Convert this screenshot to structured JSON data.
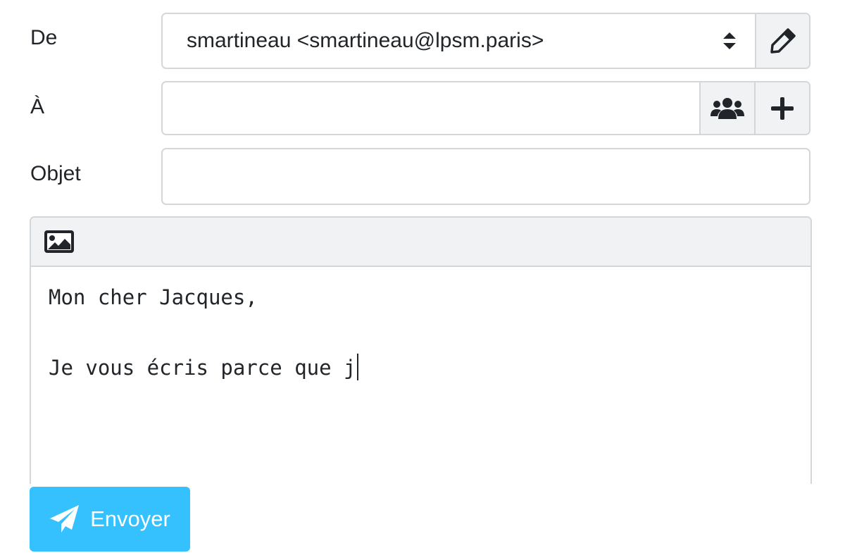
{
  "from": {
    "label": "De",
    "selected": "smartineau <smartineau@lpsm.paris>",
    "sort_icon": "sort-arrows-icon",
    "edit_icon": "pencil-icon"
  },
  "to": {
    "label": "À",
    "value": "",
    "contacts_icon": "users-icon",
    "add_icon": "plus-icon"
  },
  "subject": {
    "label": "Objet",
    "value": ""
  },
  "editor": {
    "toolbar_icon": "image-icon",
    "line1": "Mon cher Jacques,",
    "line2": "",
    "line3": "Je vous écris parce que j"
  },
  "send": {
    "label": "Envoyer",
    "icon": "paper-plane-icon",
    "color": "#34c1fd"
  }
}
